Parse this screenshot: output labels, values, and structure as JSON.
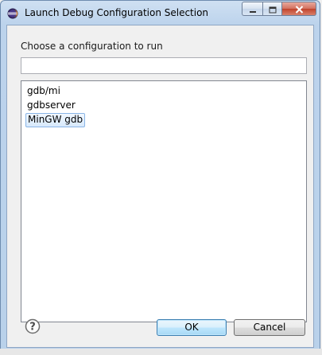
{
  "window": {
    "title": "Launch Debug Configuration Selection",
    "title_icon": "eclipse-icon",
    "controls": [
      "minimize-icon",
      "maximize-icon",
      "close-icon"
    ]
  },
  "dialog": {
    "prompt": "Choose a configuration to run",
    "filter": {
      "value": "",
      "placeholder": ""
    },
    "configurations": [
      {
        "label": "gdb/mi",
        "selected": false
      },
      {
        "label": "gdbserver",
        "selected": false
      },
      {
        "label": "MinGW gdb",
        "selected": true
      }
    ],
    "help_icon": "help-icon",
    "buttons": {
      "ok": "OK",
      "cancel": "Cancel"
    }
  },
  "colors": {
    "titlebar": "#bcd3ec",
    "selection_border": "#8ab5e6",
    "ok_border": "#3c7fb1",
    "close_button": "#c1432c"
  }
}
